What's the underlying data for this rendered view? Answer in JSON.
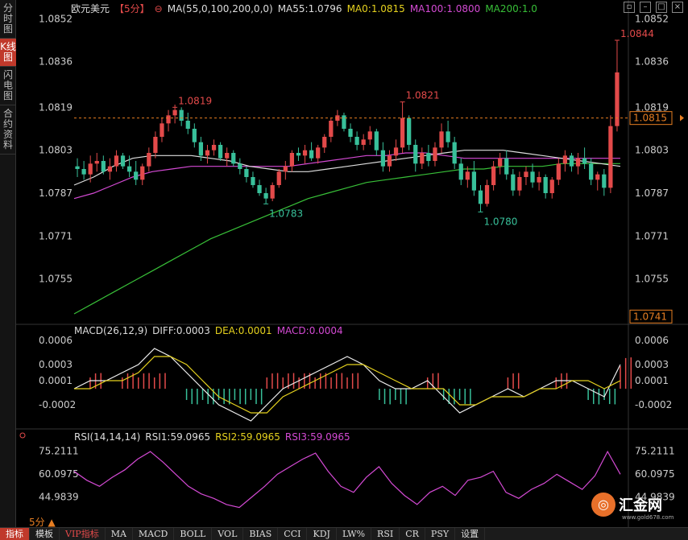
{
  "sidebar": {
    "tabs": [
      {
        "label": "分时图",
        "active": false
      },
      {
        "label": "K线图",
        "active": true
      },
      {
        "label": "闪电图",
        "active": false
      },
      {
        "label": "合约资料",
        "active": false
      }
    ]
  },
  "header": {
    "symbol": "欧元美元",
    "period": "【5分】",
    "ma_params": "MA(55,0,100,200,0,0)",
    "ma55": "MA55:1.0796",
    "ma0": "MA0:1.0815",
    "ma100": "MA100:1.0800",
    "ma200": "MA200:1.0"
  },
  "window_icons": [
    "restore-icon",
    "minimize-icon",
    "maximize-icon",
    "close-icon"
  ],
  "price_axis": {
    "ticks": [
      "1.0852",
      "1.0836",
      "1.0819",
      "1.0803",
      "1.0787",
      "1.0771",
      "1.0755"
    ],
    "current_price": "1.0815",
    "bottom_price": "1.0741"
  },
  "annotations": [
    "1.0844",
    "1.0821",
    "1.0819",
    "1.0783",
    "1.0780"
  ],
  "macd": {
    "title": "MACD(26,12,9)",
    "diff": "DIFF:0.0003",
    "dea": "DEA:0.0001",
    "macd": "MACD:0.0004",
    "ticks": [
      "0.0006",
      "0.0003",
      "0.0001",
      "-0.0002"
    ]
  },
  "rsi": {
    "title": "RSI(14,14,14)",
    "rsi1": "RSI1:59.0965",
    "rsi2": "RSI2:59.0965",
    "rsi3": "RSI3:59.0965",
    "ticks": [
      "75.2111",
      "60.0975",
      "44.9839"
    ]
  },
  "period_label": "5分 ▲",
  "bottom_tabs": [
    "指标",
    "模板",
    "VIP指标",
    "MA",
    "MACD",
    "BOLL",
    "VOL",
    "BIAS",
    "CCI",
    "KDJ",
    "LW%",
    "RSI",
    "CR",
    "PSY",
    "设置"
  ],
  "logo": {
    "name": "汇金网",
    "url": "www.gold678.com"
  },
  "colors": {
    "up": "#e34a4a",
    "down": "#38c09a",
    "ma55": "#dddddd",
    "ma100": "#d44ad4",
    "ma200": "#38c038",
    "dea": "#e6d21e"
  },
  "chart_data": {
    "type": "candlestick",
    "ylim": [
      1.0739,
      1.0856
    ],
    "ohlc": [
      [
        1.0797,
        1.08,
        1.0793,
        1.0796
      ],
      [
        1.0796,
        1.0799,
        1.0792,
        1.0794
      ],
      [
        1.0794,
        1.0801,
        1.0791,
        1.0798
      ],
      [
        1.0798,
        1.0802,
        1.0795,
        1.0799
      ],
      [
        1.0799,
        1.0801,
        1.0794,
        1.0795
      ],
      [
        1.0795,
        1.08,
        1.0792,
        1.0797
      ],
      [
        1.0797,
        1.0803,
        1.0795,
        1.0801
      ],
      [
        1.0801,
        1.0802,
        1.0796,
        1.0797
      ],
      [
        1.0797,
        1.0801,
        1.0793,
        1.0795
      ],
      [
        1.0795,
        1.0799,
        1.079,
        1.0792
      ],
      [
        1.0792,
        1.0798,
        1.079,
        1.0797
      ],
      [
        1.0797,
        1.0804,
        1.0795,
        1.0802
      ],
      [
        1.0802,
        1.081,
        1.08,
        1.0808
      ],
      [
        1.0808,
        1.0815,
        1.0806,
        1.0813
      ],
      [
        1.0813,
        1.0818,
        1.081,
        1.0816
      ],
      [
        1.0816,
        1.082,
        1.0813,
        1.0818
      ],
      [
        1.0818,
        1.0819,
        1.0812,
        1.0814
      ],
      [
        1.0814,
        1.0817,
        1.0809,
        1.0811
      ],
      [
        1.0811,
        1.0813,
        1.0804,
        1.0806
      ],
      [
        1.0806,
        1.0808,
        1.0799,
        1.0801
      ],
      [
        1.0801,
        1.0805,
        1.0798,
        1.0803
      ],
      [
        1.0803,
        1.0807,
        1.0801,
        1.0805
      ],
      [
        1.0805,
        1.0806,
        1.0799,
        1.08
      ],
      [
        1.08,
        1.0804,
        1.0797,
        1.0802
      ],
      [
        1.0802,
        1.0803,
        1.0797,
        1.0798
      ],
      [
        1.0798,
        1.08,
        1.0794,
        1.0796
      ],
      [
        1.0796,
        1.0797,
        1.0791,
        1.0793
      ],
      [
        1.0793,
        1.0795,
        1.0789,
        1.079
      ],
      [
        1.079,
        1.0792,
        1.0786,
        1.0787
      ],
      [
        1.0787,
        1.0789,
        1.0783,
        1.0785
      ],
      [
        1.0785,
        1.0791,
        1.0784,
        1.079
      ],
      [
        1.079,
        1.0796,
        1.0789,
        1.0795
      ],
      [
        1.0795,
        1.0799,
        1.0792,
        1.0797
      ],
      [
        1.0797,
        1.0803,
        1.0795,
        1.0802
      ],
      [
        1.0802,
        1.0804,
        1.0799,
        1.0801
      ],
      [
        1.0801,
        1.0805,
        1.0798,
        1.0803
      ],
      [
        1.0803,
        1.0806,
        1.0799,
        1.08
      ],
      [
        1.08,
        1.0805,
        1.0798,
        1.0804
      ],
      [
        1.0804,
        1.0809,
        1.0802,
        1.0808
      ],
      [
        1.0808,
        1.0815,
        1.0806,
        1.0814
      ],
      [
        1.0814,
        1.0818,
        1.0812,
        1.0816
      ],
      [
        1.0816,
        1.0817,
        1.081,
        1.0811
      ],
      [
        1.0811,
        1.0813,
        1.0806,
        1.0808
      ],
      [
        1.0808,
        1.081,
        1.0803,
        1.0805
      ],
      [
        1.0805,
        1.0809,
        1.0803,
        1.0807
      ],
      [
        1.0807,
        1.0812,
        1.0805,
        1.081
      ],
      [
        1.081,
        1.0811,
        1.0801,
        1.0803
      ],
      [
        1.0803,
        1.0806,
        1.0795,
        1.0797
      ],
      [
        1.0797,
        1.0803,
        1.0795,
        1.0801
      ],
      [
        1.0801,
        1.0807,
        1.0799,
        1.0804
      ],
      [
        1.0804,
        1.0821,
        1.0802,
        1.0815
      ],
      [
        1.0815,
        1.0816,
        1.0803,
        1.0805
      ],
      [
        1.0805,
        1.0807,
        1.0795,
        1.0798
      ],
      [
        1.0798,
        1.0804,
        1.0796,
        1.0802
      ],
      [
        1.0802,
        1.0805,
        1.0797,
        1.0799
      ],
      [
        1.0799,
        1.0806,
        1.0797,
        1.0804
      ],
      [
        1.0804,
        1.0813,
        1.0802,
        1.081
      ],
      [
        1.081,
        1.0814,
        1.0804,
        1.0806
      ],
      [
        1.0806,
        1.0808,
        1.0796,
        1.0798
      ],
      [
        1.0798,
        1.08,
        1.079,
        1.0792
      ],
      [
        1.0792,
        1.0797,
        1.0789,
        1.0795
      ],
      [
        1.0795,
        1.0799,
        1.0786,
        1.0788
      ],
      [
        1.0788,
        1.079,
        1.078,
        1.0783
      ],
      [
        1.0783,
        1.0792,
        1.0782,
        1.079
      ],
      [
        1.079,
        1.0799,
        1.0788,
        1.0797
      ],
      [
        1.0797,
        1.0802,
        1.0794,
        1.08
      ],
      [
        1.08,
        1.0803,
        1.0792,
        1.0794
      ],
      [
        1.0794,
        1.0796,
        1.0786,
        1.0788
      ],
      [
        1.0788,
        1.0795,
        1.0786,
        1.0793
      ],
      [
        1.0793,
        1.0797,
        1.079,
        1.0795
      ],
      [
        1.0795,
        1.0798,
        1.0789,
        1.0791
      ],
      [
        1.0791,
        1.0795,
        1.0788,
        1.0793
      ],
      [
        1.0793,
        1.0794,
        1.0785,
        1.0787
      ],
      [
        1.0787,
        1.0793,
        1.0785,
        1.0792
      ],
      [
        1.0792,
        1.08,
        1.079,
        1.0798
      ],
      [
        1.0798,
        1.0803,
        1.0795,
        1.0801
      ],
      [
        1.0801,
        1.0802,
        1.0795,
        1.0797
      ],
      [
        1.0797,
        1.0802,
        1.0794,
        1.08
      ],
      [
        1.08,
        1.0804,
        1.0796,
        1.0798
      ],
      [
        1.0798,
        1.08,
        1.079,
        1.0792
      ],
      [
        1.0792,
        1.0795,
        1.0788,
        1.0794
      ],
      [
        1.0794,
        1.0796,
        1.0786,
        1.0789
      ],
      [
        1.0789,
        1.0816,
        1.0787,
        1.0812
      ],
      [
        1.0812,
        1.0844,
        1.081,
        1.0832
      ]
    ],
    "ma55": [
      1.079,
      1.0793,
      1.0797,
      1.08,
      1.0801,
      1.0801,
      1.0801,
      1.08,
      1.0799,
      1.0797,
      1.0796,
      1.0795,
      1.0795,
      1.0796,
      1.0797,
      1.0798,
      1.0799,
      1.08,
      1.0801,
      1.0802,
      1.0803,
      1.0803,
      1.0803,
      1.0802,
      1.0801,
      1.08,
      1.0799,
      1.0798,
      1.0797
    ],
    "ma100": [
      1.0785,
      1.0787,
      1.079,
      1.0793,
      1.0795,
      1.0796,
      1.0797,
      1.0797,
      1.0797,
      1.0797,
      1.0797,
      1.0797,
      1.0798,
      1.0799,
      1.08,
      1.0801,
      1.0801,
      1.0802,
      1.0802,
      1.0801,
      1.08,
      1.08,
      1.08,
      1.08,
      1.08,
      1.08,
      1.08,
      1.08,
      1.08
    ],
    "ma200": [
      1.0742,
      1.0746,
      1.075,
      1.0754,
      1.0758,
      1.0762,
      1.0766,
      1.077,
      1.0773,
      1.0776,
      1.0779,
      1.0782,
      1.0785,
      1.0787,
      1.0789,
      1.0791,
      1.0792,
      1.0793,
      1.0794,
      1.0795,
      1.0796,
      1.0796,
      1.0797,
      1.0797,
      1.0797,
      1.0798,
      1.0798,
      1.0798,
      1.0798
    ],
    "macd_ylim": [
      -0.00045,
      0.00065
    ],
    "diff": [
      0.0,
      0.0001,
      0.0001,
      0.0002,
      0.0003,
      0.0005,
      0.0004,
      0.0002,
      0.0,
      -0.0002,
      -0.0003,
      -0.0004,
      -0.0002,
      0.0,
      0.0001,
      0.0002,
      0.0003,
      0.0004,
      0.0003,
      0.0001,
      0.0,
      0.0,
      0.0001,
      -0.0001,
      -0.0003,
      -0.0002,
      -0.0001,
      0.0,
      -0.0001,
      0.0,
      0.0001,
      0.0001,
      0.0,
      -0.0001,
      0.0003
    ],
    "dea": [
      0.0,
      0.0,
      0.0001,
      0.0001,
      0.0002,
      0.0004,
      0.0004,
      0.0003,
      0.0001,
      -0.0001,
      -0.0002,
      -0.0003,
      -0.0003,
      -0.0001,
      0.0,
      0.0001,
      0.0002,
      0.0003,
      0.0003,
      0.0002,
      0.0001,
      0.0,
      0.0,
      0.0,
      -0.0002,
      -0.0002,
      -0.0001,
      -0.0001,
      -0.0001,
      0.0,
      0.0,
      0.0001,
      0.0001,
      0.0,
      0.0001
    ],
    "rsi_ylim": [
      33,
      82
    ],
    "rsi": [
      62,
      56,
      52,
      58,
      63,
      70,
      75,
      68,
      60,
      52,
      47,
      44,
      40,
      38,
      45,
      52,
      60,
      65,
      70,
      74,
      62,
      52,
      48,
      58,
      65,
      54,
      46,
      40,
      48,
      52,
      46,
      56,
      58,
      62,
      48,
      44,
      50,
      54,
      60,
      55,
      50,
      59,
      75,
      60
    ]
  }
}
